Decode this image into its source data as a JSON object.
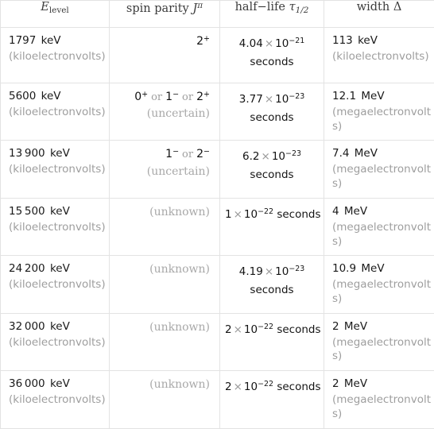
{
  "table": {
    "name": "nuclear-energy-levels-table",
    "columns": [
      {
        "id": "energy",
        "label_main": "E",
        "label_sub": "level"
      },
      {
        "id": "spin",
        "label_main": "spin parity",
        "label_sym": "J",
        "label_sup": "π"
      },
      {
        "id": "half",
        "label_main": "half−life",
        "label_sym": "τ",
        "label_sub": "1/2"
      },
      {
        "id": "width",
        "label_main": "width",
        "label_sym": "Δ"
      }
    ],
    "rows": [
      {
        "energy_value": "1797",
        "energy_unit_abbr": "keV",
        "energy_unit_full": "(kiloelectronvolts)",
        "spin_terms": [
          {
            "j": "2",
            "parity": "+"
          }
        ],
        "spin_qualifier": "",
        "half_mantissa": "4.04",
        "half_times": "×",
        "half_base": "10",
        "half_exponent": "−21",
        "half_unit": "seconds",
        "half_wraps": true,
        "width_value": "113",
        "width_unit_abbr": "keV",
        "width_unit_full": "(kiloelectronvolts)"
      },
      {
        "energy_value": "5600",
        "energy_unit_abbr": "keV",
        "energy_unit_full": "(kiloelectronvolts)",
        "spin_terms": [
          {
            "j": "0",
            "parity": "+"
          },
          {
            "j": "1",
            "parity": "−"
          },
          {
            "j": "2",
            "parity": "+"
          }
        ],
        "spin_separator": "or",
        "spin_qualifier": "(uncertain)",
        "half_mantissa": "3.77",
        "half_times": "×",
        "half_base": "10",
        "half_exponent": "−23",
        "half_unit": "seconds",
        "half_wraps": true,
        "width_value": "12.1",
        "width_unit_abbr": "MeV",
        "width_unit_full": "(megaelectronvolts)"
      },
      {
        "energy_value": "13 900",
        "energy_unit_abbr": "keV",
        "energy_unit_full": "(kiloelectronvolts)",
        "spin_terms": [
          {
            "j": "1",
            "parity": "−"
          },
          {
            "j": "2",
            "parity": "−"
          }
        ],
        "spin_separator": "or",
        "spin_qualifier": "(uncertain)",
        "half_mantissa": "6.2",
        "half_times": "×",
        "half_base": "10",
        "half_exponent": "−23",
        "half_unit": "seconds",
        "half_wraps": true,
        "width_value": "7.4",
        "width_unit_abbr": "MeV",
        "width_unit_full": "(megaelectronvolts)"
      },
      {
        "energy_value": "15 500",
        "energy_unit_abbr": "keV",
        "energy_unit_full": "(kiloelectronvolts)",
        "spin_terms": [],
        "spin_qualifier": "(unknown)",
        "half_mantissa": "1",
        "half_times": "×",
        "half_base": "10",
        "half_exponent": "−22",
        "half_unit": "seconds",
        "half_wraps": false,
        "width_value": "4",
        "width_unit_abbr": "MeV",
        "width_unit_full": "(megaelectronvolts)"
      },
      {
        "energy_value": "24 200",
        "energy_unit_abbr": "keV",
        "energy_unit_full": "(kiloelectronvolts)",
        "spin_terms": [],
        "spin_qualifier": "(unknown)",
        "half_mantissa": "4.19",
        "half_times": "×",
        "half_base": "10",
        "half_exponent": "−23",
        "half_unit": "seconds",
        "half_wraps": true,
        "width_value": "10.9",
        "width_unit_abbr": "MeV",
        "width_unit_full": "(megaelectronvolts)"
      },
      {
        "energy_value": "32 000",
        "energy_unit_abbr": "keV",
        "energy_unit_full": "(kiloelectronvolts)",
        "spin_terms": [],
        "spin_qualifier": "(unknown)",
        "half_mantissa": "2",
        "half_times": "×",
        "half_base": "10",
        "half_exponent": "−22",
        "half_unit": "seconds",
        "half_wraps": false,
        "width_value": "2",
        "width_unit_abbr": "MeV",
        "width_unit_full": "(megaelectronvolts)"
      },
      {
        "energy_value": "36 000",
        "energy_unit_abbr": "keV",
        "energy_unit_full": "(kiloelectronvolts)",
        "spin_terms": [],
        "spin_qualifier": "(unknown)",
        "half_mantissa": "2",
        "half_times": "×",
        "half_base": "10",
        "half_exponent": "−22",
        "half_unit": "seconds",
        "half_wraps": false,
        "width_value": "2",
        "width_unit_abbr": "MeV",
        "width_unit_full": "(megaelectronvolts)"
      }
    ]
  },
  "colors": {
    "border": "#e3e3e3",
    "text": "#1a1a1a",
    "muted": "#9e9e9e",
    "header": "#3c3c3c"
  }
}
